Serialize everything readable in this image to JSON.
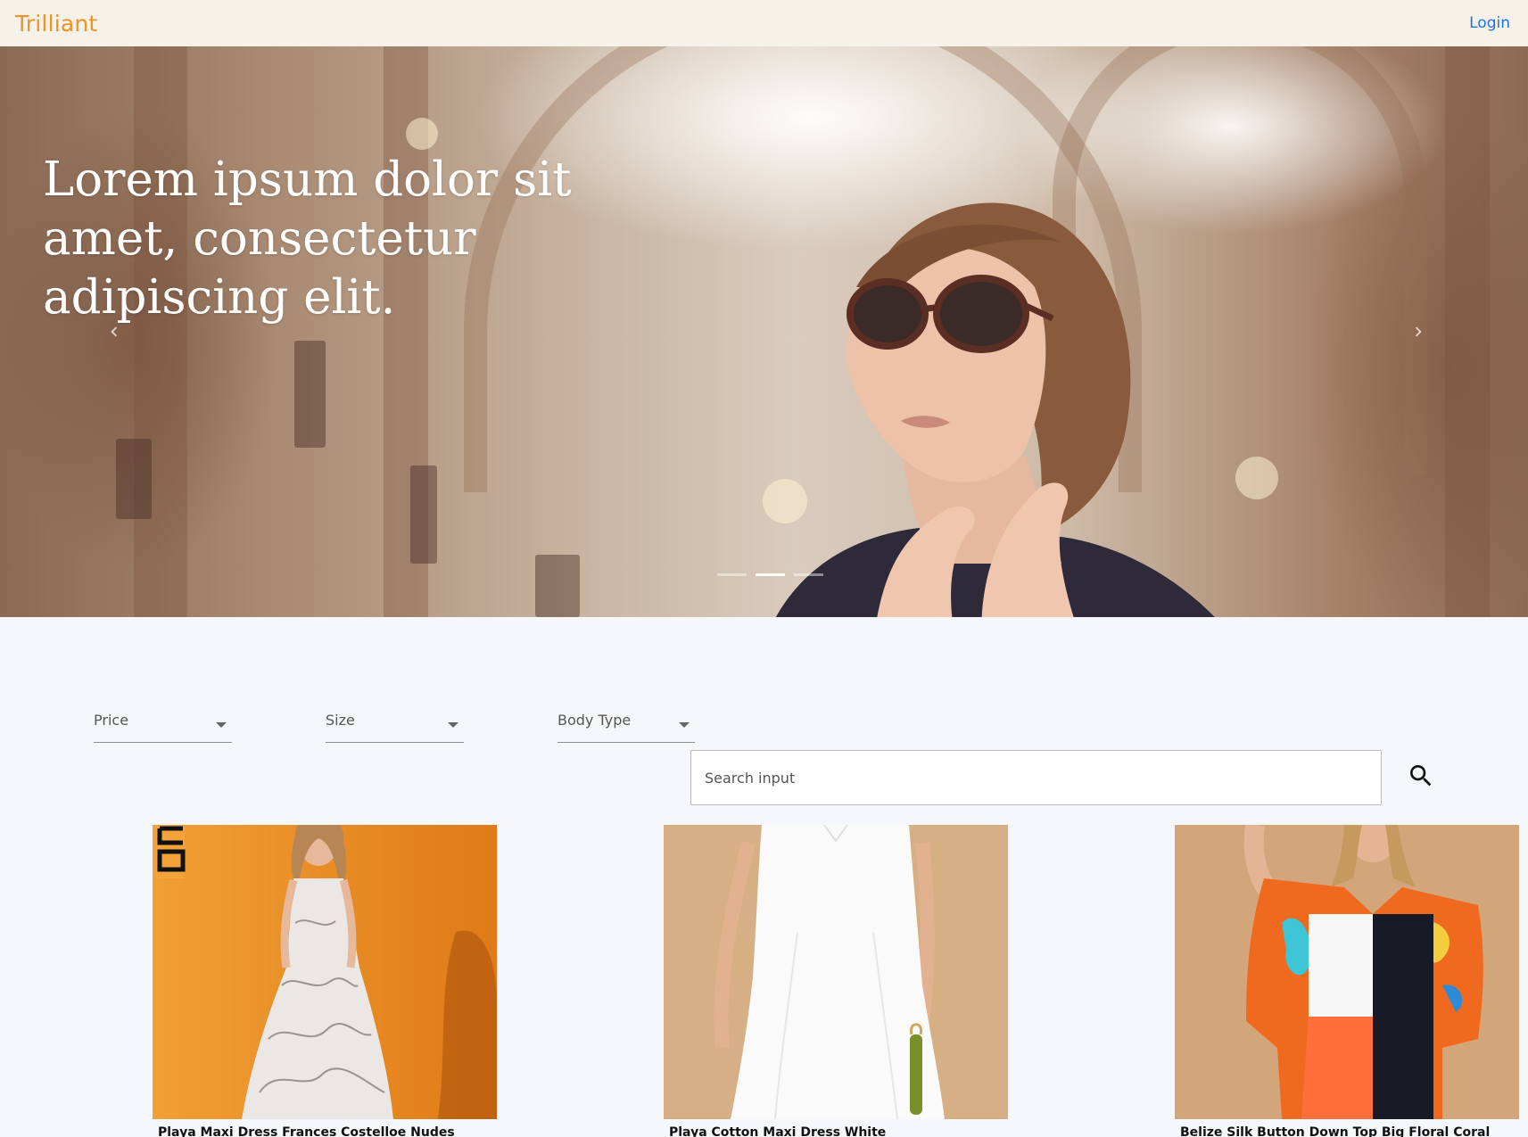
{
  "navbar": {
    "brand": "Trilliant",
    "login_label": "Login"
  },
  "hero": {
    "headline": "Lorem ipsum dolor sit amet, consectetur adipiscing elit.",
    "prev_icon": "chevron-left-icon",
    "next_icon": "chevron-right-icon",
    "slide_count": 3,
    "active_slide": 2
  },
  "filters": {
    "price_label": "Price",
    "size_label": "Size",
    "body_type_label": "Body Type"
  },
  "search": {
    "placeholder": "Search input",
    "icon": "search-icon"
  },
  "products": [
    {
      "name": "Playa Maxi Dress Frances Costelloe Nudes"
    },
    {
      "name": "Playa Cotton Maxi Dress White"
    },
    {
      "name": "Belize Silk Button Down Top Big Floral Coral"
    }
  ],
  "colors": {
    "brand": "#f09327",
    "link": "#1a73e8",
    "navbar_bg": "#f6f2ea",
    "page_bg": "#f6f7fa"
  }
}
